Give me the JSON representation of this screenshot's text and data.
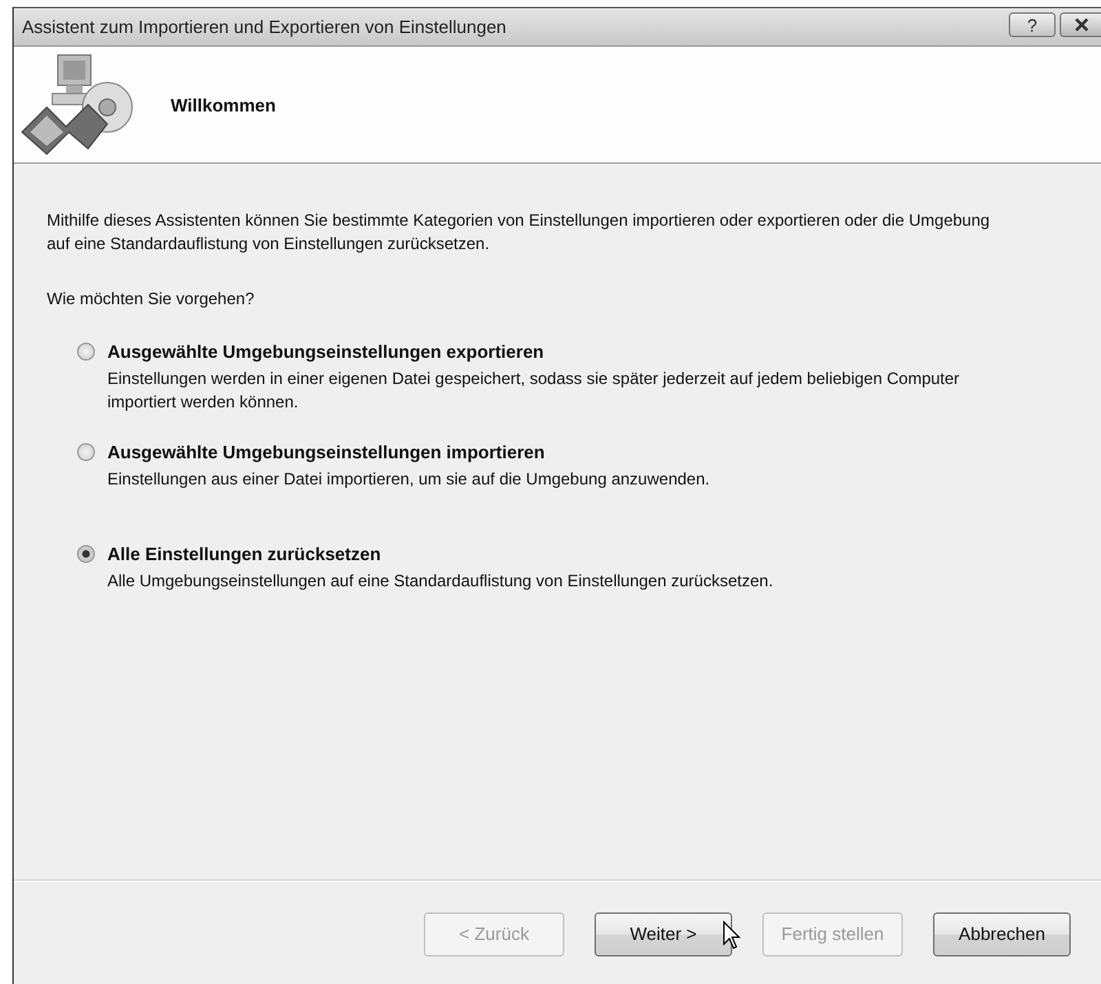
{
  "window": {
    "title": "Assistent zum Importieren und Exportieren von Einstellungen",
    "help_button": "?"
  },
  "header": {
    "title": "Willkommen"
  },
  "intro": "Mithilfe dieses Assistenten können Sie bestimmte Kategorien von Einstellungen importieren oder exportieren oder die Umgebung auf eine Standardauflistung von Einstellungen zurücksetzen.",
  "question": "Wie möchten Sie vorgehen?",
  "options": [
    {
      "label": "Ausgewählte Umgebungseinstellungen exportieren",
      "description": "Einstellungen werden in einer eigenen Datei gespeichert, sodass sie später jederzeit auf jedem beliebigen Computer importiert werden können.",
      "selected": false
    },
    {
      "label": "Ausgewählte Umgebungseinstellungen importieren",
      "description": "Einstellungen aus einer Datei importieren, um sie auf die Umgebung anzuwenden.",
      "selected": false
    },
    {
      "label": "Alle Einstellungen zurücksetzen",
      "description": "Alle Umgebungseinstellungen auf eine Standardauflistung von Einstellungen zurücksetzen.",
      "selected": true
    }
  ],
  "buttons": [
    {
      "label": "< Zurück",
      "disabled": true
    },
    {
      "label": "Weiter >",
      "disabled": false
    },
    {
      "label": "Fertig stellen",
      "disabled": true
    },
    {
      "label": "Abbrechen",
      "disabled": false
    }
  ]
}
